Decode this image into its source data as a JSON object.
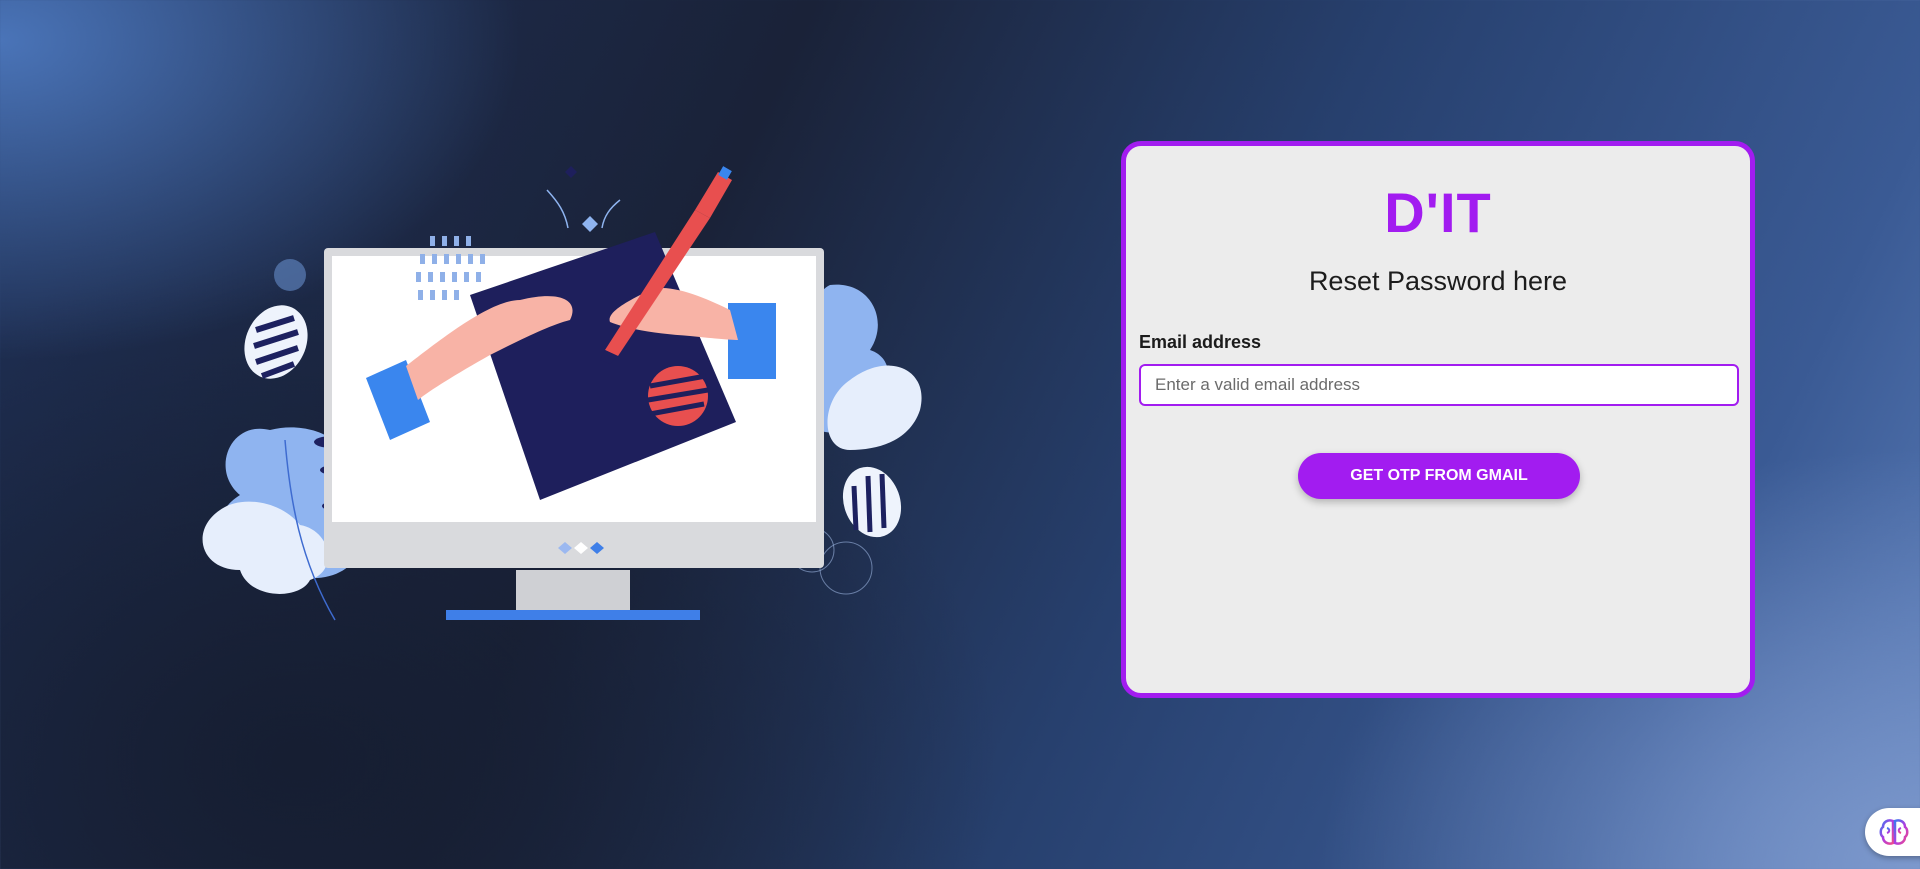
{
  "brand": {
    "logo_text": "D'IT",
    "accent_color": "#a21cf0"
  },
  "form": {
    "title": "Reset Password here",
    "email_label": "Email address",
    "email_placeholder": "Enter a valid email address",
    "email_value": "",
    "submit_label": "GET OTP FROM GMAIL"
  },
  "illustration": {
    "icon": "designer-monitor-illustration"
  },
  "assistant_widget": {
    "icon": "brain-icon"
  }
}
